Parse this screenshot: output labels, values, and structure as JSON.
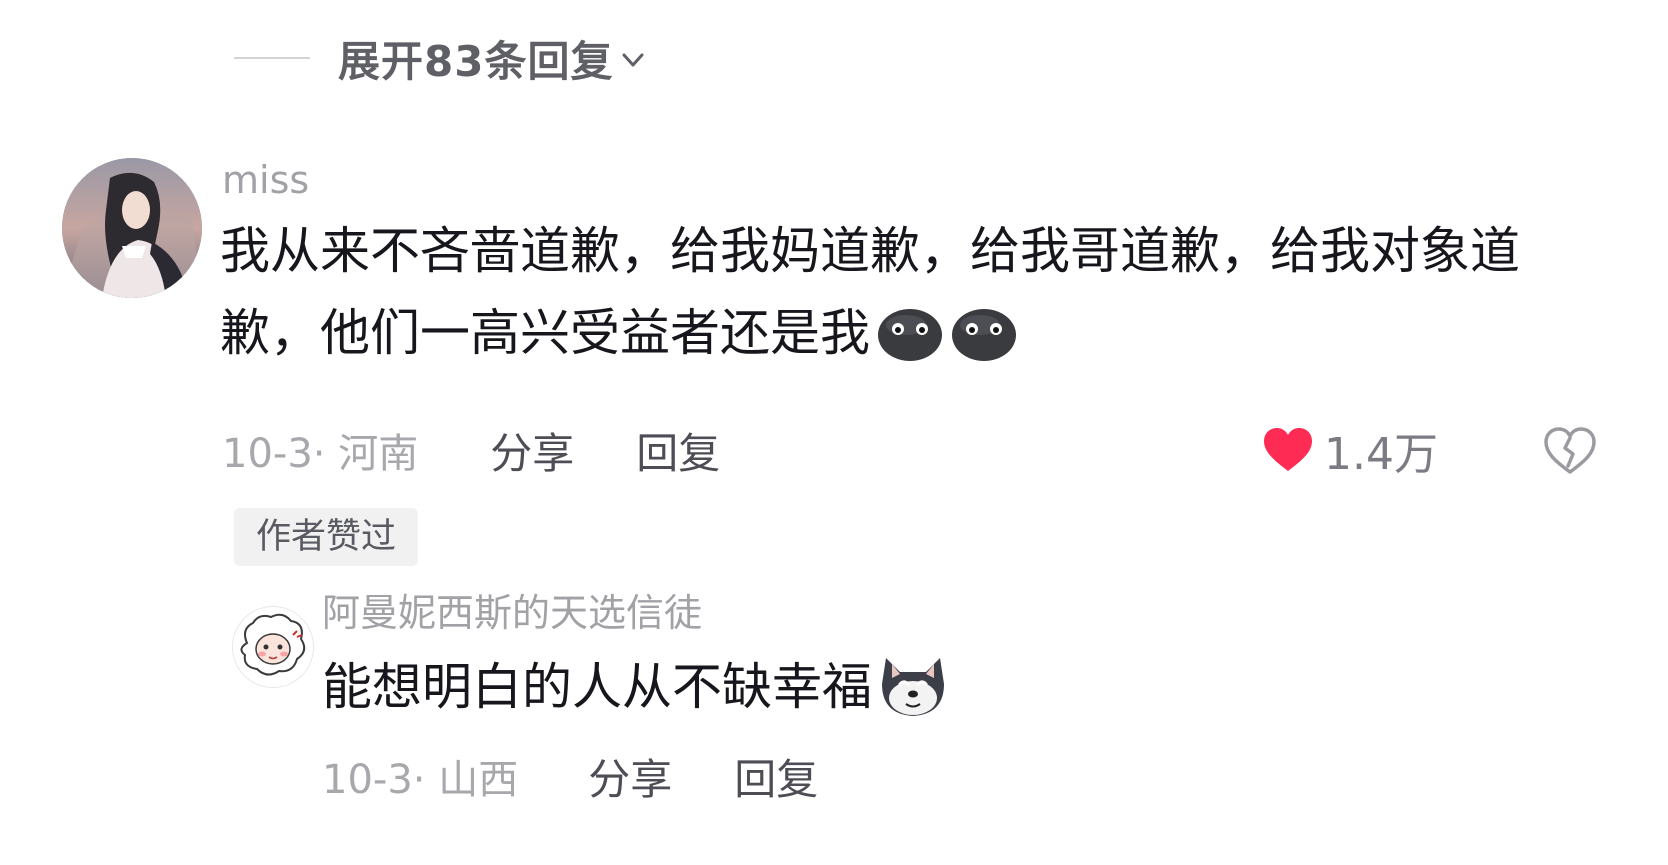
{
  "expand_replies": {
    "label": "展开83条回复"
  },
  "comments": [
    {
      "username": "miss",
      "text": "我从来不吝啬道歉，给我妈道歉，给我哥道歉，给我对象道歉，他们一高兴受益者还是我",
      "date_location": "10-3· 河南",
      "share_label": "分享",
      "reply_label": "回复",
      "like_count": "1.4万",
      "author_liked_badge": "作者赞过",
      "emojis": [
        "black-smile-emoji",
        "black-smile-emoji"
      ]
    },
    {
      "username": "阿曼妮西斯的天选信徒",
      "text": "能想明白的人从不缺幸福",
      "date_location": "10-3· 山西",
      "share_label": "分享",
      "reply_label": "回复",
      "emojis": [
        "shiba-dog-emoji"
      ]
    }
  ],
  "colors": {
    "like_heart": "#fe2c55",
    "username": "#a1a1a6",
    "text": "#16161c"
  }
}
